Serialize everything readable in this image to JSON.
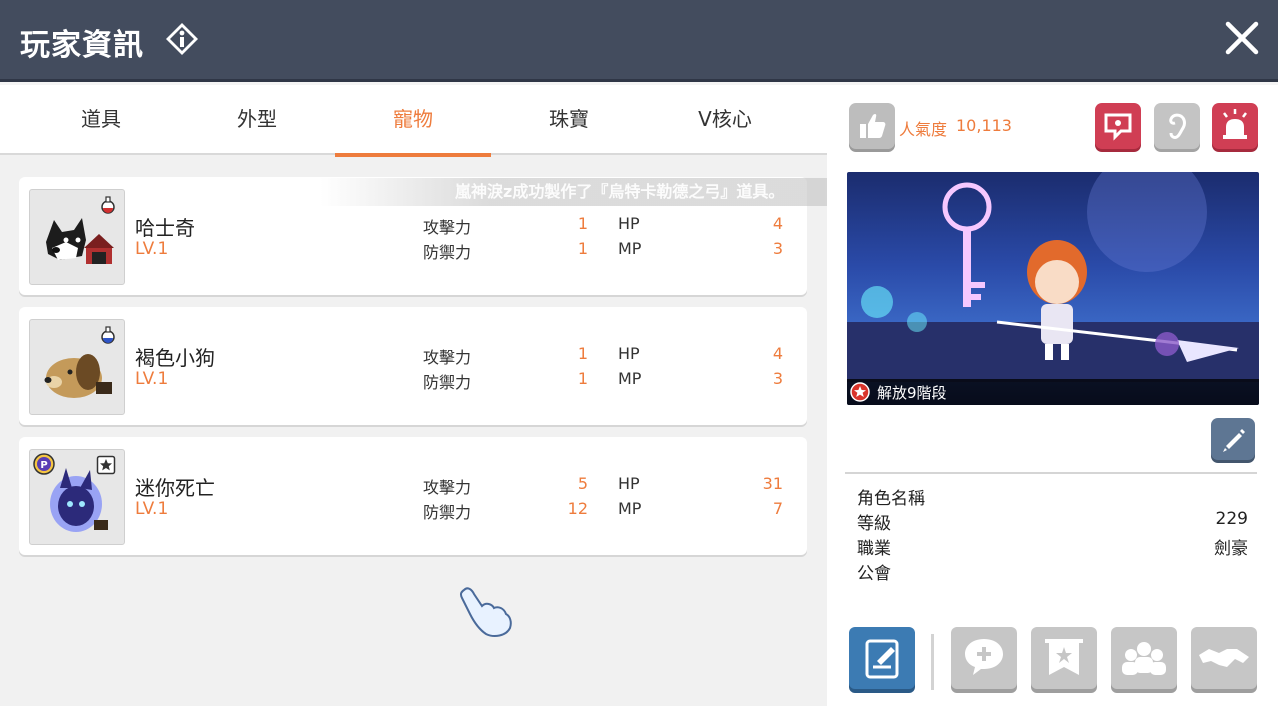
{
  "header": {
    "title": "玩家資訊"
  },
  "tabs": [
    {
      "label": "道具"
    },
    {
      "label": "外型"
    },
    {
      "label": "寵物",
      "active": true
    },
    {
      "label": "珠寶"
    },
    {
      "label": "V核心"
    }
  ],
  "stat_labels": {
    "attack": "攻擊力",
    "defense": "防禦力",
    "hp": "HP",
    "mp": "MP"
  },
  "pets": [
    {
      "name": "哈士奇",
      "level": "LV.1",
      "attack": "1",
      "defense": "1",
      "hp": "4",
      "mp": "3"
    },
    {
      "name": "褐色小狗",
      "level": "LV.1",
      "attack": "1",
      "defense": "1",
      "hp": "4",
      "mp": "3"
    },
    {
      "name": "迷你死亡",
      "level": "LV.1",
      "attack": "5",
      "defense": "12",
      "hp": "31",
      "mp": "7"
    }
  ],
  "broadcast": "嵐神淚z成功製作了『烏特卡勒德之弓』道具。",
  "popularity": {
    "label": "人氣度",
    "value": "10,113"
  },
  "portrait": {
    "caption": "解放9階段"
  },
  "character_info": [
    {
      "label": "角色名稱",
      "value": ""
    },
    {
      "label": "等級",
      "value": "229"
    },
    {
      "label": "職業",
      "value": "劍豪"
    },
    {
      "label": "公會",
      "value": ""
    }
  ],
  "colors": {
    "accent": "#ee7c3d",
    "header": "#434c5e",
    "danger": "#d03e54",
    "primary": "#3c7bb3"
  },
  "icons": [
    "info-icon",
    "close-icon",
    "thumbs-up-icon",
    "report-icon",
    "ear-icon",
    "siren-icon",
    "pencil-icon",
    "notebook-icon",
    "chat-add-icon",
    "guild-banner-icon",
    "party-icon",
    "handshake-icon",
    "hand-cursor-icon"
  ]
}
